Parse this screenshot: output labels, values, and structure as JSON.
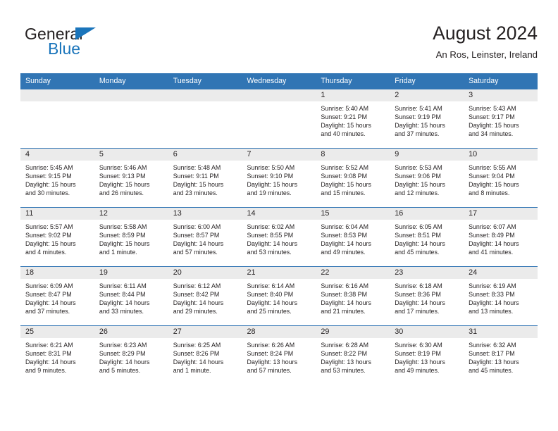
{
  "brand": {
    "word_general": "General",
    "word_blue": "Blue"
  },
  "header": {
    "title": "August 2024",
    "subtitle": "An Ros, Leinster, Ireland"
  },
  "colors": {
    "header_blue": "#3175b4",
    "logo_blue": "#1b75bb",
    "daynum_bg": "#ebebeb",
    "text": "#231f20"
  },
  "weekdays": [
    "Sunday",
    "Monday",
    "Tuesday",
    "Wednesday",
    "Thursday",
    "Friday",
    "Saturday"
  ],
  "weeks": [
    [
      {
        "day": "",
        "sunrise": "",
        "sunset": "",
        "daylight1": "",
        "daylight2": ""
      },
      {
        "day": "",
        "sunrise": "",
        "sunset": "",
        "daylight1": "",
        "daylight2": ""
      },
      {
        "day": "",
        "sunrise": "",
        "sunset": "",
        "daylight1": "",
        "daylight2": ""
      },
      {
        "day": "",
        "sunrise": "",
        "sunset": "",
        "daylight1": "",
        "daylight2": ""
      },
      {
        "day": "1",
        "sunrise": "Sunrise: 5:40 AM",
        "sunset": "Sunset: 9:21 PM",
        "daylight1": "Daylight: 15 hours",
        "daylight2": "and 40 minutes."
      },
      {
        "day": "2",
        "sunrise": "Sunrise: 5:41 AM",
        "sunset": "Sunset: 9:19 PM",
        "daylight1": "Daylight: 15 hours",
        "daylight2": "and 37 minutes."
      },
      {
        "day": "3",
        "sunrise": "Sunrise: 5:43 AM",
        "sunset": "Sunset: 9:17 PM",
        "daylight1": "Daylight: 15 hours",
        "daylight2": "and 34 minutes."
      }
    ],
    [
      {
        "day": "4",
        "sunrise": "Sunrise: 5:45 AM",
        "sunset": "Sunset: 9:15 PM",
        "daylight1": "Daylight: 15 hours",
        "daylight2": "and 30 minutes."
      },
      {
        "day": "5",
        "sunrise": "Sunrise: 5:46 AM",
        "sunset": "Sunset: 9:13 PM",
        "daylight1": "Daylight: 15 hours",
        "daylight2": "and 26 minutes."
      },
      {
        "day": "6",
        "sunrise": "Sunrise: 5:48 AM",
        "sunset": "Sunset: 9:11 PM",
        "daylight1": "Daylight: 15 hours",
        "daylight2": "and 23 minutes."
      },
      {
        "day": "7",
        "sunrise": "Sunrise: 5:50 AM",
        "sunset": "Sunset: 9:10 PM",
        "daylight1": "Daylight: 15 hours",
        "daylight2": "and 19 minutes."
      },
      {
        "day": "8",
        "sunrise": "Sunrise: 5:52 AM",
        "sunset": "Sunset: 9:08 PM",
        "daylight1": "Daylight: 15 hours",
        "daylight2": "and 15 minutes."
      },
      {
        "day": "9",
        "sunrise": "Sunrise: 5:53 AM",
        "sunset": "Sunset: 9:06 PM",
        "daylight1": "Daylight: 15 hours",
        "daylight2": "and 12 minutes."
      },
      {
        "day": "10",
        "sunrise": "Sunrise: 5:55 AM",
        "sunset": "Sunset: 9:04 PM",
        "daylight1": "Daylight: 15 hours",
        "daylight2": "and 8 minutes."
      }
    ],
    [
      {
        "day": "11",
        "sunrise": "Sunrise: 5:57 AM",
        "sunset": "Sunset: 9:02 PM",
        "daylight1": "Daylight: 15 hours",
        "daylight2": "and 4 minutes."
      },
      {
        "day": "12",
        "sunrise": "Sunrise: 5:58 AM",
        "sunset": "Sunset: 8:59 PM",
        "daylight1": "Daylight: 15 hours",
        "daylight2": "and 1 minute."
      },
      {
        "day": "13",
        "sunrise": "Sunrise: 6:00 AM",
        "sunset": "Sunset: 8:57 PM",
        "daylight1": "Daylight: 14 hours",
        "daylight2": "and 57 minutes."
      },
      {
        "day": "14",
        "sunrise": "Sunrise: 6:02 AM",
        "sunset": "Sunset: 8:55 PM",
        "daylight1": "Daylight: 14 hours",
        "daylight2": "and 53 minutes."
      },
      {
        "day": "15",
        "sunrise": "Sunrise: 6:04 AM",
        "sunset": "Sunset: 8:53 PM",
        "daylight1": "Daylight: 14 hours",
        "daylight2": "and 49 minutes."
      },
      {
        "day": "16",
        "sunrise": "Sunrise: 6:05 AM",
        "sunset": "Sunset: 8:51 PM",
        "daylight1": "Daylight: 14 hours",
        "daylight2": "and 45 minutes."
      },
      {
        "day": "17",
        "sunrise": "Sunrise: 6:07 AM",
        "sunset": "Sunset: 8:49 PM",
        "daylight1": "Daylight: 14 hours",
        "daylight2": "and 41 minutes."
      }
    ],
    [
      {
        "day": "18",
        "sunrise": "Sunrise: 6:09 AM",
        "sunset": "Sunset: 8:47 PM",
        "daylight1": "Daylight: 14 hours",
        "daylight2": "and 37 minutes."
      },
      {
        "day": "19",
        "sunrise": "Sunrise: 6:11 AM",
        "sunset": "Sunset: 8:44 PM",
        "daylight1": "Daylight: 14 hours",
        "daylight2": "and 33 minutes."
      },
      {
        "day": "20",
        "sunrise": "Sunrise: 6:12 AM",
        "sunset": "Sunset: 8:42 PM",
        "daylight1": "Daylight: 14 hours",
        "daylight2": "and 29 minutes."
      },
      {
        "day": "21",
        "sunrise": "Sunrise: 6:14 AM",
        "sunset": "Sunset: 8:40 PM",
        "daylight1": "Daylight: 14 hours",
        "daylight2": "and 25 minutes."
      },
      {
        "day": "22",
        "sunrise": "Sunrise: 6:16 AM",
        "sunset": "Sunset: 8:38 PM",
        "daylight1": "Daylight: 14 hours",
        "daylight2": "and 21 minutes."
      },
      {
        "day": "23",
        "sunrise": "Sunrise: 6:18 AM",
        "sunset": "Sunset: 8:36 PM",
        "daylight1": "Daylight: 14 hours",
        "daylight2": "and 17 minutes."
      },
      {
        "day": "24",
        "sunrise": "Sunrise: 6:19 AM",
        "sunset": "Sunset: 8:33 PM",
        "daylight1": "Daylight: 14 hours",
        "daylight2": "and 13 minutes."
      }
    ],
    [
      {
        "day": "25",
        "sunrise": "Sunrise: 6:21 AM",
        "sunset": "Sunset: 8:31 PM",
        "daylight1": "Daylight: 14 hours",
        "daylight2": "and 9 minutes."
      },
      {
        "day": "26",
        "sunrise": "Sunrise: 6:23 AM",
        "sunset": "Sunset: 8:29 PM",
        "daylight1": "Daylight: 14 hours",
        "daylight2": "and 5 minutes."
      },
      {
        "day": "27",
        "sunrise": "Sunrise: 6:25 AM",
        "sunset": "Sunset: 8:26 PM",
        "daylight1": "Daylight: 14 hours",
        "daylight2": "and 1 minute."
      },
      {
        "day": "28",
        "sunrise": "Sunrise: 6:26 AM",
        "sunset": "Sunset: 8:24 PM",
        "daylight1": "Daylight: 13 hours",
        "daylight2": "and 57 minutes."
      },
      {
        "day": "29",
        "sunrise": "Sunrise: 6:28 AM",
        "sunset": "Sunset: 8:22 PM",
        "daylight1": "Daylight: 13 hours",
        "daylight2": "and 53 minutes."
      },
      {
        "day": "30",
        "sunrise": "Sunrise: 6:30 AM",
        "sunset": "Sunset: 8:19 PM",
        "daylight1": "Daylight: 13 hours",
        "daylight2": "and 49 minutes."
      },
      {
        "day": "31",
        "sunrise": "Sunrise: 6:32 AM",
        "sunset": "Sunset: 8:17 PM",
        "daylight1": "Daylight: 13 hours",
        "daylight2": "and 45 minutes."
      }
    ]
  ]
}
